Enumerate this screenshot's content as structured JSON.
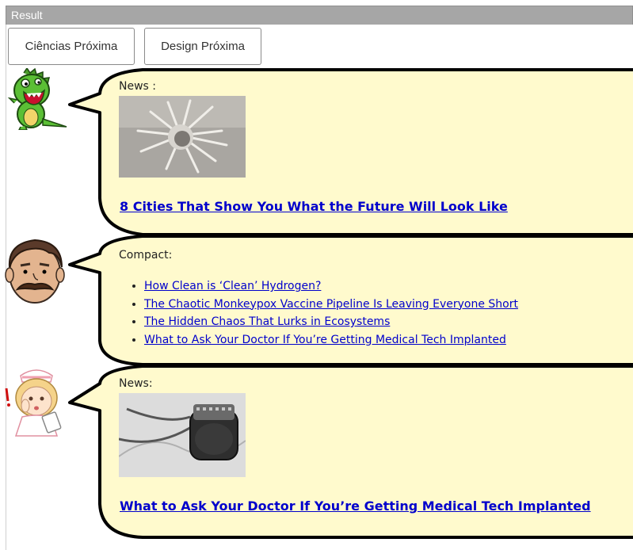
{
  "window": {
    "title": "Result"
  },
  "buttons": [
    {
      "label": "Ciências Próxima"
    },
    {
      "label": "Design Próxima"
    }
  ],
  "posts": [
    {
      "avatar": "green-dinosaur-icon",
      "label": "News :",
      "image": "spiky-sculpture-photo",
      "headline": "8 Cities That Show You What the Future Will Look Like"
    },
    {
      "avatar": "mustached-man-icon",
      "label": "Compact:",
      "links": [
        "How Clean is ‘Clean’ Hydrogen?",
        "The Chaotic Monkeypox Vaccine Pipeline Is Leaving Everyone Short",
        "The Hidden Chaos That Lurks in Ecosystems",
        "What to Ask Your Doctor If You’re Getting Medical Tech Implanted"
      ]
    },
    {
      "avatar": "nurse-icon",
      "label": "News:",
      "image": "medical-implant-photo",
      "headline": "What to Ask Your Doctor If You’re Getting Medical Tech Implanted"
    }
  ],
  "colors": {
    "bubble_fill": "#fffacd",
    "bubble_stroke": "#000000",
    "link": "#0000cc",
    "titlebar": "#a6a6a6"
  }
}
